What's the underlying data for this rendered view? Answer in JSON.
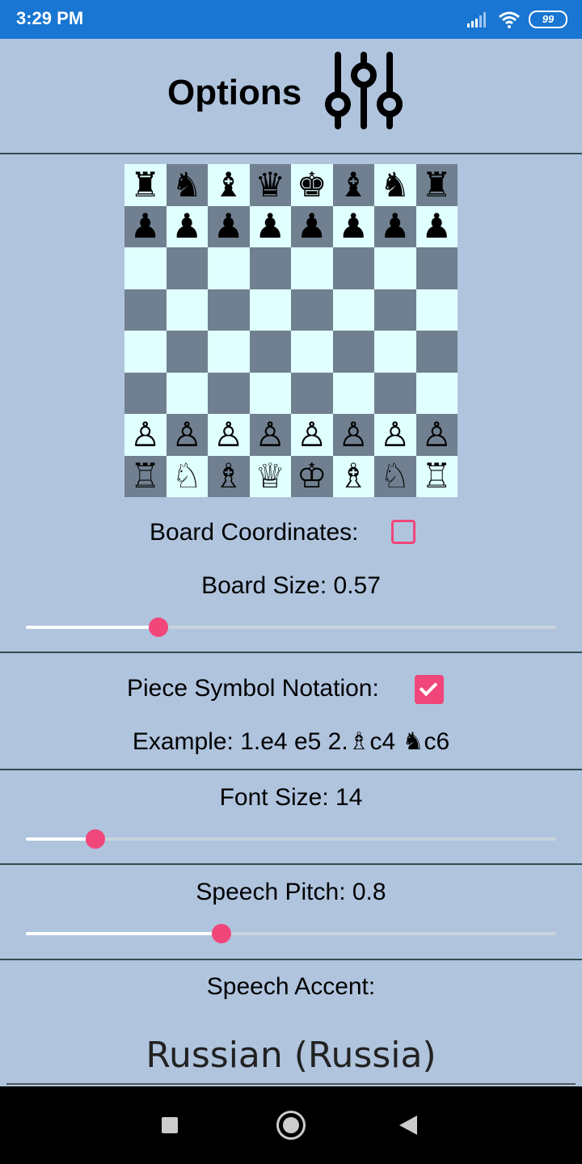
{
  "status_bar": {
    "time": "3:29 PM",
    "battery": "99",
    "icons": [
      "signal-icon",
      "wifi-icon",
      "battery-icon"
    ]
  },
  "header": {
    "title": "Options",
    "icon": "sliders-icon"
  },
  "board": {
    "light_color": "#e0ffff",
    "dark_color": "#708090",
    "ranks": [
      [
        "♜",
        "♞",
        "♝",
        "♛",
        "♚",
        "♝",
        "♞",
        "♜"
      ],
      [
        "♟",
        "♟",
        "♟",
        "♟",
        "♟",
        "♟",
        "♟",
        "♟"
      ],
      [
        "",
        "",
        "",
        "",
        "",
        "",
        "",
        ""
      ],
      [
        "",
        "",
        "",
        "",
        "",
        "",
        "",
        ""
      ],
      [
        "",
        "",
        "",
        "",
        "",
        "",
        "",
        ""
      ],
      [
        "",
        "",
        "",
        "",
        "",
        "",
        "",
        ""
      ],
      [
        "♙",
        "♙",
        "♙",
        "♙",
        "♙",
        "♙",
        "♙",
        "♙"
      ],
      [
        "♖",
        "♘",
        "♗",
        "♕",
        "♔",
        "♗",
        "♘",
        "♖"
      ]
    ]
  },
  "board_coordinates": {
    "label": "Board Coordinates:",
    "checked": false
  },
  "board_size": {
    "label": "Board Size: 0.57",
    "value": 0.25
  },
  "piece_symbol_notation": {
    "label": "Piece Symbol Notation:",
    "checked": true
  },
  "example": {
    "text": "Example: 1.e4 e5 2.♗c4 ♞c6"
  },
  "font_size": {
    "label": "Font Size: 14",
    "value": 0.131
  },
  "speech_pitch": {
    "label": "Speech Pitch: 0.8",
    "value": 0.369
  },
  "speech_accent": {
    "label": "Speech Accent:",
    "value": "Russian (Russia)"
  },
  "colors": {
    "background": "#b0c4de",
    "accent": "#f0467a",
    "status_bar": "#1976d2"
  }
}
